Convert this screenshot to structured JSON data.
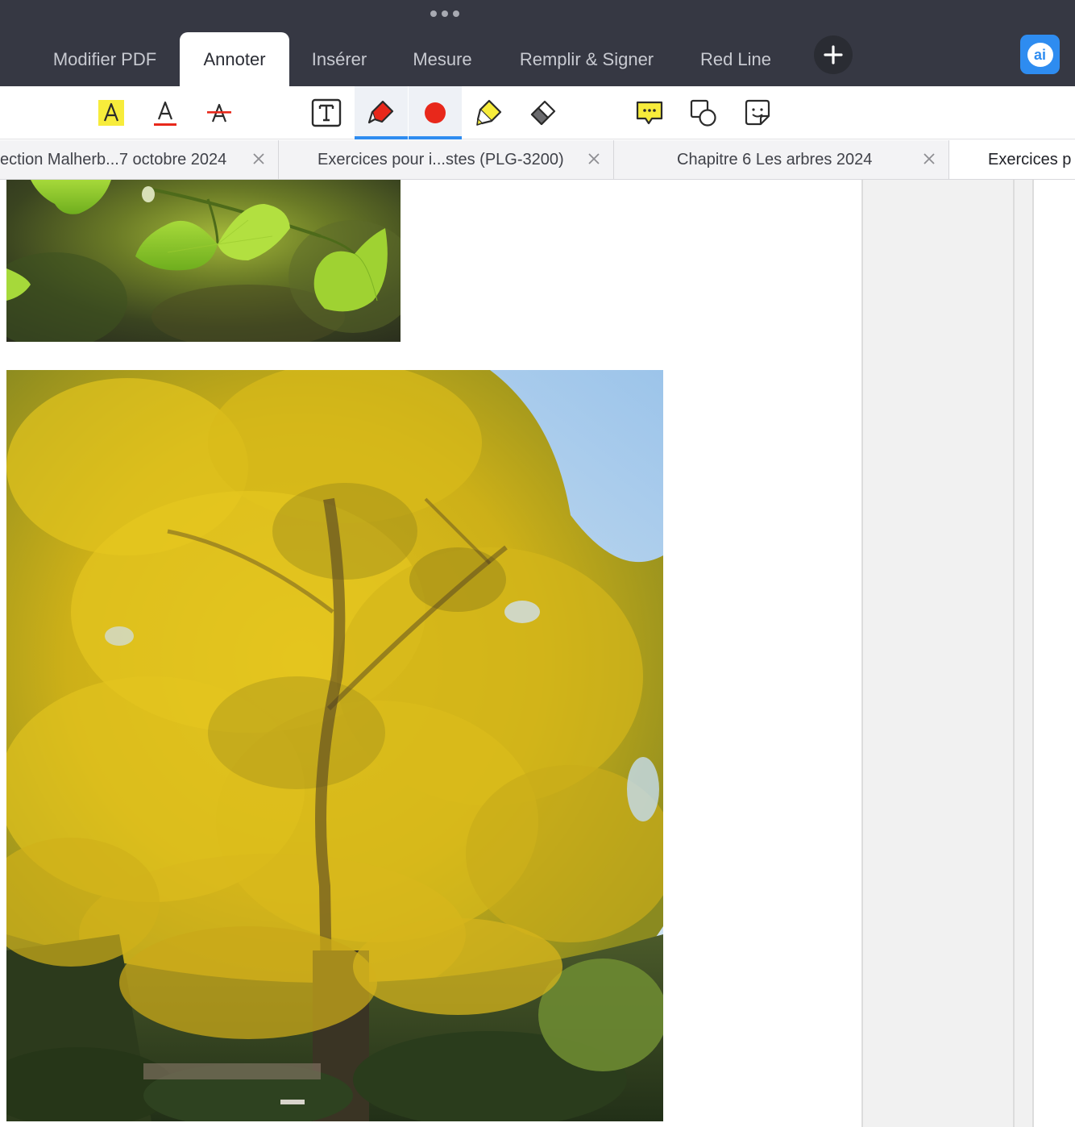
{
  "main_tabs": [
    {
      "label": "Modifier PDF"
    },
    {
      "label": "Annoter"
    },
    {
      "label": "Insérer"
    },
    {
      "label": "Mesure"
    },
    {
      "label": "Remplir & Signer"
    },
    {
      "label": "Red Line"
    }
  ],
  "active_main_tab": "Annoter",
  "ai_button": {
    "label": "ai"
  },
  "tools": [
    {
      "icon": "highlight-text-icon"
    },
    {
      "icon": "underline-text-icon"
    },
    {
      "icon": "strikethrough-text-icon"
    },
    {
      "icon": "text-box-icon"
    },
    {
      "icon": "pen-icon",
      "selected": true
    },
    {
      "icon": "color-swatch-icon",
      "selected": true,
      "color": "#e8281b"
    },
    {
      "icon": "highlighter-icon"
    },
    {
      "icon": "eraser-icon"
    },
    {
      "icon": "comment-icon"
    },
    {
      "icon": "shapes-icon"
    },
    {
      "icon": "sticker-icon"
    }
  ],
  "doc_tabs": [
    {
      "label": "ection Malherb...7 octobre 2024"
    },
    {
      "label": "Exercices pour i...stes (PLG-3200)"
    },
    {
      "label": "Chapitre 6 Les arbres  2024"
    },
    {
      "label": "Exercices p"
    }
  ],
  "colors": {
    "topbar": "#363843",
    "accent": "#2e8cf0",
    "pen_color": "#e8281b",
    "highlight_yellow": "#f7ec3b",
    "ginkgo_yellow": "#d9b81a",
    "leaf_green": "#8fc92c"
  }
}
